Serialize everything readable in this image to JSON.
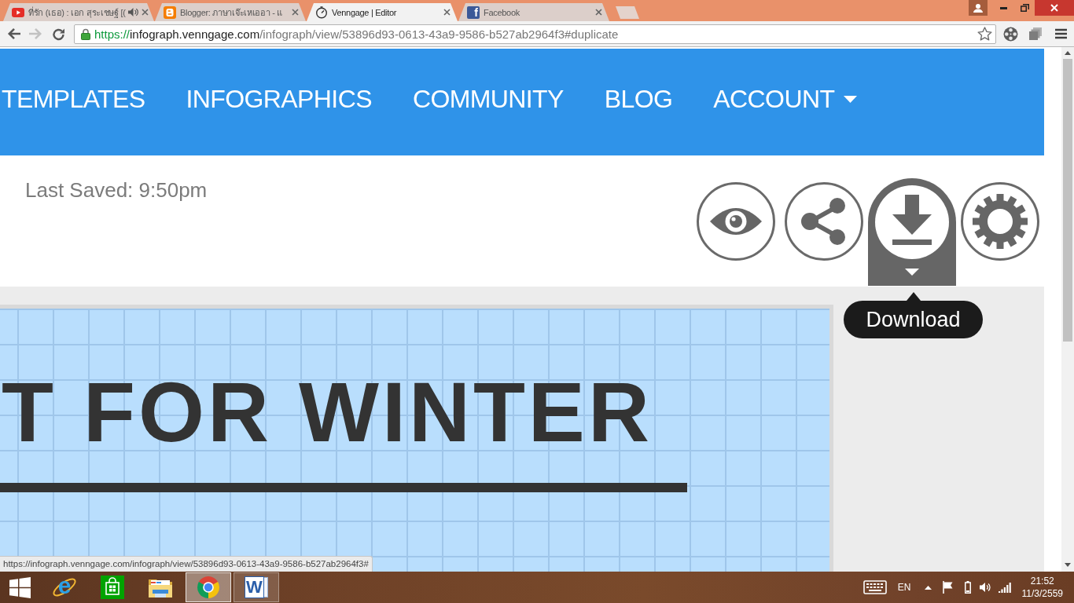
{
  "browser": {
    "tabs": [
      {
        "kind": "video",
        "title": "ที่รัก (เธอ) : เอก สุระเชษฐ์ [(",
        "audio": true,
        "selected": false
      },
      {
        "kind": "blog",
        "title": "Blogger: ภาษาเจ๊ะเหเออา - แ",
        "audio": false,
        "selected": false
      },
      {
        "kind": "clock",
        "title": "Venngage | Editor",
        "audio": false,
        "selected": true
      },
      {
        "kind": "social",
        "glyph": "f",
        "title": "Facebook",
        "audio": false,
        "selected": false
      }
    ],
    "nav_buttons": [
      {
        "kind": "back",
        "disabled": false
      },
      {
        "kind": "forward",
        "disabled": true
      },
      {
        "kind": "reload",
        "disabled": false
      }
    ],
    "address": {
      "scheme": "https://",
      "host": "infograph.venngage.com",
      "path": "/infograph/view/53896d93-0613-43a9-9586-b527ab2964f3#duplicate"
    }
  },
  "page": {
    "nav": [
      {
        "label": "TEMPLATES",
        "dropdown": false
      },
      {
        "label": "INFOGRAPHICS",
        "dropdown": false
      },
      {
        "label": "COMMUNITY",
        "dropdown": false
      },
      {
        "label": "BLOG",
        "dropdown": false
      },
      {
        "label": "ACCOUNT",
        "dropdown": true
      }
    ],
    "last_saved": "Last Saved: 9:50pm",
    "actions": [
      {
        "kind": "preview",
        "highlighted": false
      },
      {
        "kind": "share",
        "highlighted": false
      },
      {
        "kind": "download",
        "highlighted": true
      },
      {
        "kind": "settings",
        "highlighted": false
      }
    ],
    "tooltip": "Download",
    "canvas": {
      "heading": "T FOR WINTER"
    }
  },
  "status_url": "https://infograph.venngage.com/infograph/view/53896d93-0613-43a9-9586-b527ab2964f3#",
  "taskbar": {
    "apps": [
      {
        "kind": "ie",
        "glyph": "e",
        "open": false,
        "selected": false
      },
      {
        "kind": "store",
        "open": false,
        "selected": false
      },
      {
        "kind": "explorer",
        "open": false,
        "selected": false
      },
      {
        "kind": "chrome",
        "open": true,
        "selected": true
      },
      {
        "kind": "word",
        "glyph": "W",
        "open": true,
        "selected": false
      }
    ],
    "language": "EN",
    "time": "21:52",
    "date": "11/3/2559"
  }
}
